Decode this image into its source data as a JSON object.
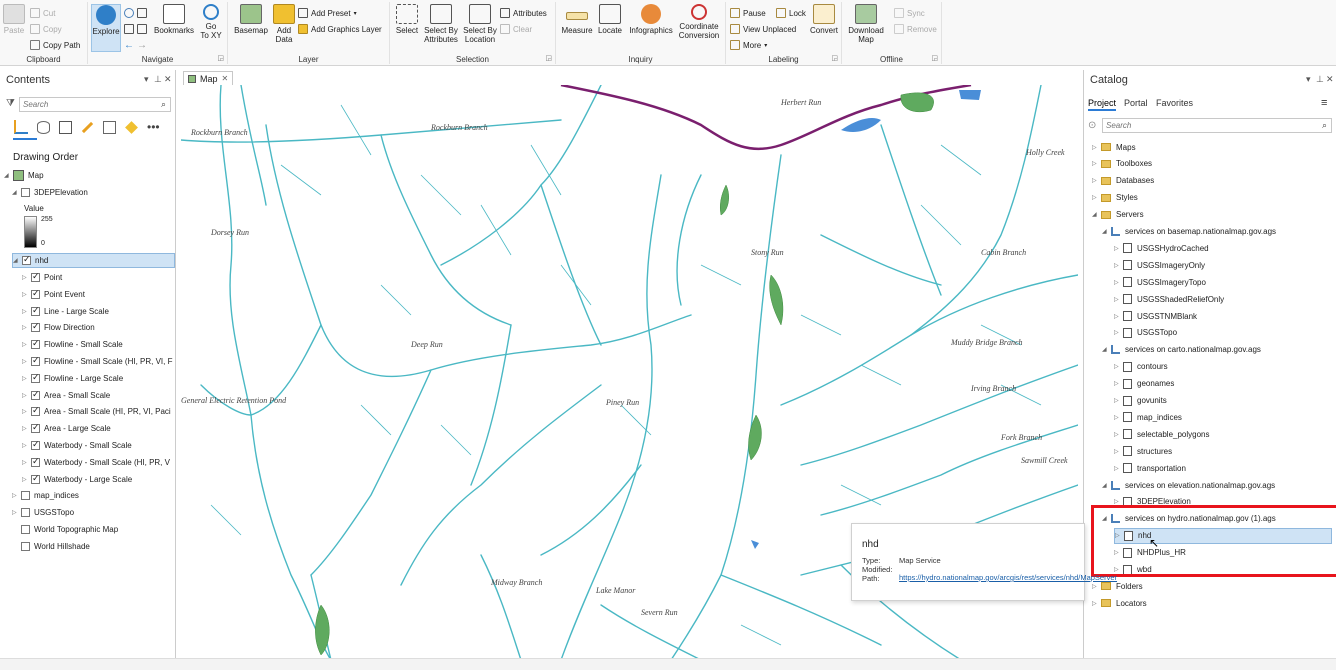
{
  "ribbon": {
    "clipboard": {
      "paste": "Paste",
      "cut": "Cut",
      "copy": "Copy",
      "copy_path": "Copy Path",
      "label": "Clipboard"
    },
    "navigate": {
      "explore": "Explore",
      "bookmarks": "Bookmarks",
      "goto": "Go\nTo XY",
      "label": "Navigate"
    },
    "layer": {
      "basemap": "Basemap",
      "add_data": "Add\nData",
      "add_preset": "Add Preset",
      "add_graphics": "Add Graphics Layer",
      "label": "Layer"
    },
    "selection": {
      "select": "Select",
      "select_by_attr": "Select By\nAttributes",
      "select_by_loc": "Select By\nLocation",
      "attributes": "Attributes",
      "clear": "Clear",
      "label": "Selection"
    },
    "inquiry": {
      "measure": "Measure",
      "locate": "Locate",
      "infographics": "Infographics",
      "coord": "Coordinate\nConversion",
      "label": "Inquiry"
    },
    "labeling": {
      "pause": "Pause",
      "lock": "Lock",
      "view_unplaced": "View Unplaced",
      "more": "More",
      "convert": "Convert",
      "label": "Labeling"
    },
    "offline": {
      "download": "Download\nMap",
      "sync": "Sync",
      "remove": "Remove",
      "label": "Offline"
    }
  },
  "contents": {
    "title": "Contents",
    "search_placeholder": "Search",
    "drawing_order": "Drawing Order",
    "map": "Map",
    "elevation": "3DEPElevation",
    "value_label": "Value",
    "value_max": "255",
    "value_min": "0",
    "nhd": "nhd",
    "layers": [
      "Point",
      "Point Event",
      "Line - Large Scale",
      "Flow Direction",
      "Flowline - Small Scale",
      "Flowline - Small Scale (HI, PR, VI, F",
      "Flowline - Large Scale",
      "Area - Small Scale",
      "Area - Small Scale (HI, PR, VI, Paci",
      "Area - Large Scale",
      "Waterbody - Small Scale",
      "Waterbody - Small Scale (HI, PR, V",
      "Waterbody - Large Scale"
    ],
    "other_layers": [
      "map_indices",
      "USGSTopo",
      "World Topographic Map",
      "World Hillshade"
    ]
  },
  "map_tab": "Map",
  "map_labels": {
    "rockburn1": "Rockburn Branch",
    "rockburn2": "Rockburn Branch",
    "deep_run": "Deep Run",
    "dorsey_run": "Dorsey Run",
    "piney_run": "Piney Run",
    "stony_run": "Stony Run",
    "ge_pond": "General Electric Retention Pond",
    "cabin": "Cabin Branch",
    "muddy": "Muddy Bridge Branch",
    "irving": "Irving Branch",
    "fork": "Fork Branch",
    "sawmill": "Sawmill Creek",
    "holly": "Holly Creek",
    "midway": "Midway Branch",
    "lake_manor": "Lake Manor",
    "severn": "Severn Run",
    "herbert": "Herbert Run"
  },
  "catalog": {
    "title": "Catalog",
    "tabs": [
      "Project",
      "Portal",
      "Favorites"
    ],
    "search_placeholder": "Search",
    "folders": [
      "Maps",
      "Toolboxes",
      "Databases",
      "Styles",
      "Servers"
    ],
    "basemap_conn": "services on basemap.nationalmap.gov.ags",
    "basemap_items": [
      "USGSHydroCached",
      "USGSImageryOnly",
      "USGSImageryTopo",
      "USGSShadedReliefOnly",
      "USGSTNMBlank",
      "USGSTopo"
    ],
    "carto_conn": "services on carto.nationalmap.gov.ags",
    "carto_items": [
      "contours",
      "geonames",
      "govunits",
      "map_indices",
      "selectable_polygons",
      "structures",
      "transportation"
    ],
    "elev_conn": "services on elevation.nationalmap.gov.ags",
    "elev_items": [
      "3DEPElevation"
    ],
    "hydro_conn": "services on hydro.nationalmap.gov (1).ags",
    "hydro_items": [
      "nhd",
      "NHDPlus_HR",
      "wbd"
    ],
    "bottom": [
      "Folders",
      "Locators"
    ]
  },
  "tooltip": {
    "title": "nhd",
    "type_k": "Type:",
    "type_v": "Map Service",
    "modified_k": "Modified:",
    "path_k": "Path:",
    "path_v": "https://hydro.nationalmap.gov/arcgis/rest/services/nhd/MapServer"
  },
  "colors": {
    "water": "#4ab8c4",
    "road": "#7a1f6e",
    "wetland": "#5faa5f",
    "accent": "#2b7bd5",
    "highlight": "#e8141c"
  }
}
